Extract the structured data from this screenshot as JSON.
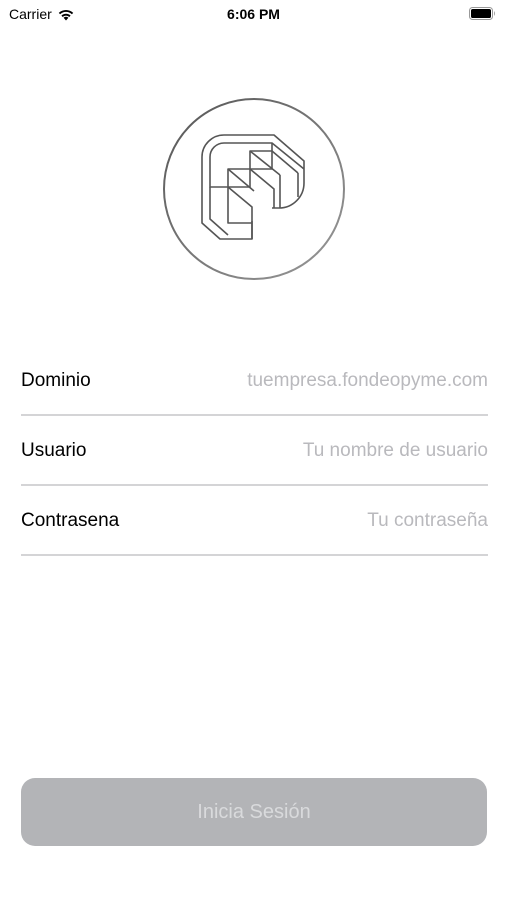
{
  "status_bar": {
    "carrier": "Carrier",
    "time": "6:06 PM",
    "wifi_icon": "wifi-icon",
    "battery_icon": "battery-icon"
  },
  "logo": {
    "icon": "fondeo-logo-icon"
  },
  "form": {
    "fields": [
      {
        "label": "Dominio",
        "placeholder": "tuempresa.fondeopyme.com",
        "value": ""
      },
      {
        "label": "Usuario",
        "placeholder": "Tu nombre de usuario",
        "value": ""
      },
      {
        "label": "Contrasena",
        "placeholder": "Tu contraseña",
        "value": ""
      }
    ]
  },
  "login_button": {
    "label": "Inicia Sesión"
  },
  "colors": {
    "button_background": "#b3b4b7",
    "button_text": "#d9dadc",
    "placeholder": "#b9b9bd",
    "divider": "#d4d4d6"
  }
}
